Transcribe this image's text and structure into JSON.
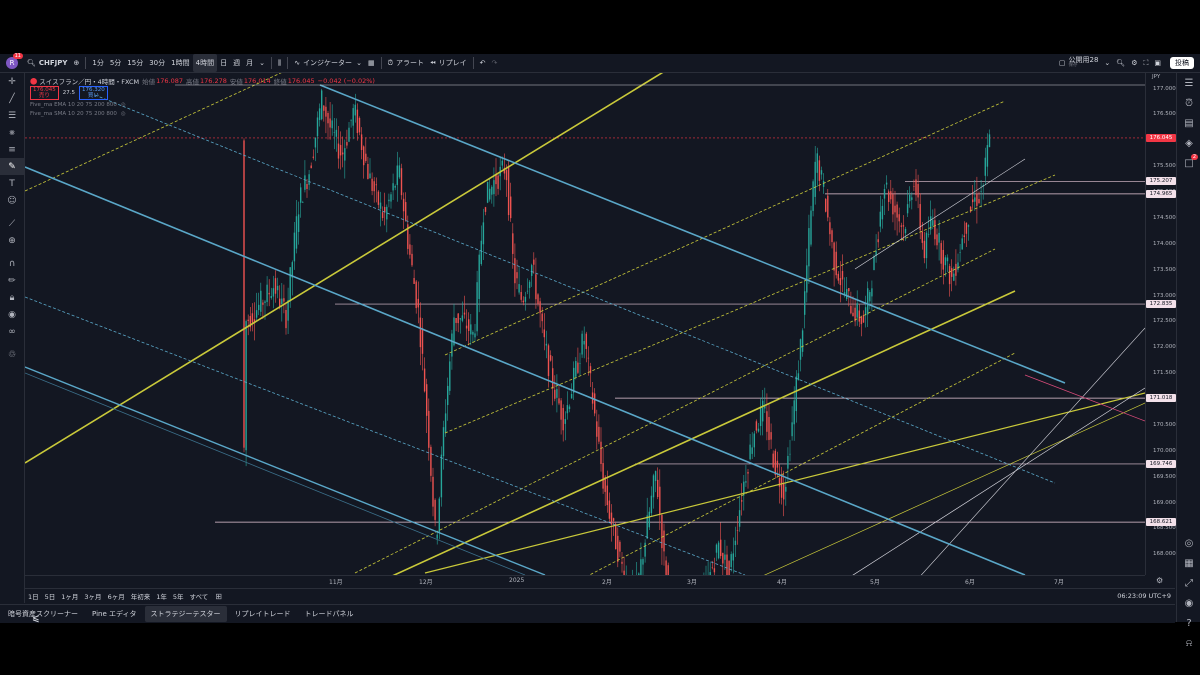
{
  "topbar": {
    "avatar_letter": "R",
    "avatar_badge": "11",
    "symbol": "CHFJPY",
    "timeframes": [
      "1分",
      "5分",
      "15分",
      "30分",
      "1時間",
      "4時間",
      "日",
      "週",
      "月"
    ],
    "active_timeframe": "4時間",
    "indicators_label": "インジケーター",
    "alert_label": "アラート",
    "replay_label": "リプレイ",
    "layout_name": "公開用28",
    "layout_sub": "保存",
    "publish_label": "投稿"
  },
  "legend": {
    "title": "スイスフラン／円・4時間・FXCM",
    "open_k": "始値",
    "open_v": "176.087",
    "high_k": "高値",
    "high_v": "176.278",
    "low_k": "安値",
    "low_v": "176.014",
    "close_k": "終値",
    "close_v": "176.045",
    "change_v": "−0.042 (−0.02%)",
    "sell_price": "176.045",
    "sell_label": "売り",
    "spread": "27.5",
    "buy_price": "176.320",
    "buy_label": "買い",
    "indicator_1": "Five_ma EMA 10 20 75 200 800",
    "indicator_2": "Five_ma SMA 10 20 75 200 800"
  },
  "price_axis": {
    "currency": "JPY",
    "ticks": [
      "177.000",
      "176.500",
      "176.000",
      "175.500",
      "175.000",
      "174.500",
      "174.000",
      "173.500",
      "173.000",
      "172.500",
      "172.000",
      "171.500",
      "171.000",
      "170.500",
      "170.000",
      "169.500",
      "169.000",
      "168.500",
      "168.000"
    ],
    "labels": [
      {
        "text": "176.045",
        "kind": "current"
      },
      {
        "text": "175.207",
        "kind": "level"
      },
      {
        "text": "174.965",
        "kind": "level"
      },
      {
        "text": "172.835",
        "kind": "level"
      },
      {
        "text": "171.018",
        "kind": "level"
      },
      {
        "text": "169.746",
        "kind": "level"
      },
      {
        "text": "168.621",
        "kind": "level"
      }
    ]
  },
  "time_axis": {
    "ticks": [
      "11月",
      "12月",
      "2025",
      "2月",
      "3月",
      "4月",
      "5月",
      "6月",
      "7月"
    ]
  },
  "range_bar": {
    "items": [
      "1日",
      "5日",
      "1ヶ月",
      "3ヶ月",
      "6ヶ月",
      "年初来",
      "1年",
      "5年",
      "すべて"
    ],
    "clock": "06:23:09 UTC+9"
  },
  "bottom_tabs": {
    "items": [
      "暗号資産スクリーナー",
      "Pine エディタ",
      "ストラテジーテスター",
      "リプレイトレード",
      "トレードパネル"
    ],
    "active": "ストラテジーテスター"
  },
  "colors": {
    "bg": "#131722",
    "candle_up": "#26a69a",
    "candle_down": "#ef5350",
    "channel_yellow": "#c9c93a",
    "channel_blue": "#5aa7c8",
    "level_line": "#e8c9d8",
    "current_price": "#f23645"
  },
  "right_badge": "2"
}
